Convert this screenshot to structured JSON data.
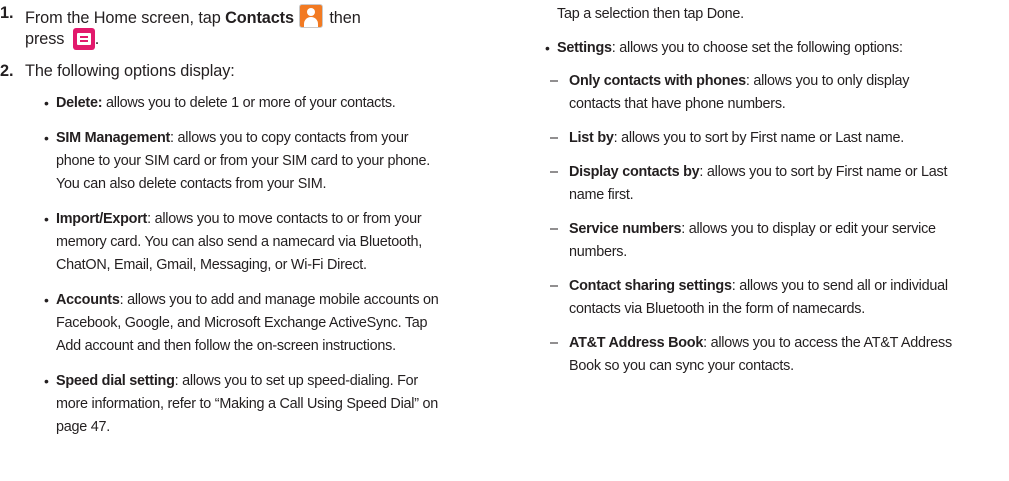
{
  "steps": [
    {
      "number": "1.",
      "line1_pre": "From the Home screen, tap ",
      "line1_bold": "Contacts",
      "line1_post": " then",
      "line2_pre": "press ",
      "line2_post": ".",
      "icon1": "contacts-app-icon",
      "icon2": "menu-key-icon"
    },
    {
      "number": "2.",
      "text": "The following options display:"
    }
  ],
  "left_items": [
    {
      "term": "Delete:",
      "lines": [
        " allows you to delete 1 or more of your contacts."
      ]
    },
    {
      "term": "SIM Management",
      "lines": [
        ": allows you to copy contacts from your",
        "phone to your SIM card or from your SIM card to your phone.",
        "You can also delete contacts from your SIM."
      ]
    },
    {
      "term": "Import/Export",
      "lines": [
        ": allows you to move contacts to or from your",
        "memory card. You can also send a namecard via Bluetooth,",
        "ChatON, Email, Gmail, Messaging, or Wi-Fi Direct."
      ]
    },
    {
      "term": "Accounts",
      "lines": [
        ": allows you to add and manage mobile accounts on",
        "Facebook, Google, and Microsoft Exchange ActiveSync. Tap",
        "Add account and then follow the on-screen instructions."
      ]
    },
    {
      "term": "Speed dial setting",
      "lines": [
        ": allows you to set up speed-dialing. For",
        "more information, refer to “Making a Call Using Speed Dial” on",
        "page 47."
      ]
    }
  ],
  "right_top_line": "Tap a selection then tap Done.",
  "settings_item": {
    "term": "Settings",
    "rest": ": allows you to choose set the following options:"
  },
  "right_subitems": [
    {
      "term": "Only contacts with phones",
      "lines": [
        ": allows you to only display",
        "contacts that have phone numbers."
      ]
    },
    {
      "term": "List by",
      "lines": [
        ": allows you to sort by First name or Last name."
      ]
    },
    {
      "term": "Display contacts by",
      "lines": [
        ": allows you to sort by First name or Last",
        "name first."
      ]
    },
    {
      "term": "Service numbers",
      "lines": [
        ": allows you to display or edit your service",
        "numbers."
      ]
    },
    {
      "term": "Contact sharing settings",
      "lines": [
        ": allows you to send all or individual",
        "contacts via Bluetooth in the form of namecards."
      ]
    },
    {
      "term": "AT&T Address Book",
      "lines": [
        ": allows you to access the AT&T Address",
        "Book so you can sync your contacts."
      ]
    }
  ],
  "glyphs": {
    "bullet": "•",
    "dash": "–"
  }
}
